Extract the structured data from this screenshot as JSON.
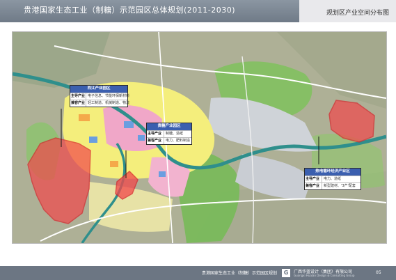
{
  "header": {
    "title": "贵港国家生态工业（制糖）示范园区总体规划(2011-2030)",
    "section": "规划区产业空间分布图"
  },
  "callouts": {
    "xijiang": {
      "title": "西江产业园区",
      "rows": [
        {
          "label": "主导产业",
          "value": "电子信息、节能环保新材料"
        },
        {
          "label": "兼容产业",
          "value": "轻工制造、机械制造、物流"
        }
      ]
    },
    "guitang": {
      "title": "贵糖产业园区",
      "rows": [
        {
          "label": "主导产业",
          "value": "制糖、造纸"
        },
        {
          "label": "兼容产业",
          "value": "电力、肥料制造"
        }
      ]
    },
    "circular": {
      "title": "热电循环经济产业区",
      "rows": [
        {
          "label": "主导产业",
          "value": "电力、造纸"
        },
        {
          "label": "兼容产业",
          "value": "新型建材、'3产'配套"
        }
      ]
    }
  },
  "footer": {
    "project": "贵港国家生态工业（制糖）示范园区规划",
    "logo": "G",
    "company": "广西华蓝设计（集团）有限公司",
    "company_en": "Guangxi Hualan Design & Consulting Group",
    "page": "05"
  },
  "colors": {
    "header": "#7a8591",
    "river": "#2f8f8c",
    "green_belt": "#78c05a",
    "residential": "#f4ee7c",
    "commercial": "#f0a7c8",
    "industrial_zone": "#f2474b",
    "callout_title": "#3b5faf"
  }
}
